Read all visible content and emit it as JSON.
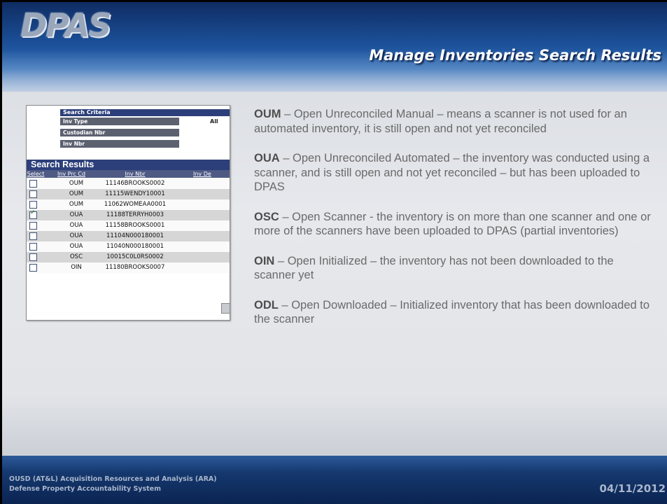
{
  "header": {
    "logo_text": "DPAS",
    "title": "Manage Inventories Search Results"
  },
  "inset": {
    "criteria_header": "Search Criteria",
    "criteria": [
      {
        "label": "Inv Type",
        "value": "All"
      },
      {
        "label": "Custodian Nbr",
        "value": ""
      },
      {
        "label": "Inv Nbr",
        "value": ""
      }
    ],
    "results_header": "Search Results",
    "columns": [
      "Select",
      "Inv Prc Cd",
      "Inv Nbr",
      "Inv De"
    ],
    "rows": [
      {
        "checked": false,
        "code": "OUM",
        "nbr": "11146BROOKS0002"
      },
      {
        "checked": false,
        "code": "OUM",
        "nbr": "11115WENDY10001"
      },
      {
        "checked": false,
        "code": "OUM",
        "nbr": "11062WOMEAA0001"
      },
      {
        "checked": true,
        "code": "OUA",
        "nbr": "11188TERRYH0003"
      },
      {
        "checked": false,
        "code": "OUA",
        "nbr": "11158BROOKS0001"
      },
      {
        "checked": false,
        "code": "OUA",
        "nbr": "11104N000180001"
      },
      {
        "checked": false,
        "code": "OUA",
        "nbr": "11040N000180001"
      },
      {
        "checked": false,
        "code": "OSC",
        "nbr": "10015C0L0RS0002"
      },
      {
        "checked": false,
        "code": "OIN",
        "nbr": "11180BROOKS0007"
      }
    ]
  },
  "definitions": [
    {
      "code": "OUM",
      "text": " – Open Unreconciled Manual – means a scanner is not used for an automated inventory, it is still open and not yet reconciled"
    },
    {
      "code": "OUA",
      "text": " – Open Unreconciled Automated – the inventory was conducted using a scanner, and is still open and not yet reconciled – but has been uploaded to DPAS"
    },
    {
      "code": "OSC",
      "text": " – Open Scanner - the inventory is on more than one scanner and one or more of the scanners have been uploaded to DPAS (partial inventories)"
    },
    {
      "code": "OIN",
      "text": " – Open Initialized – the inventory has not been downloaded to the scanner yet"
    },
    {
      "code": "ODL",
      "text": " – Open Downloaded – Initialized inventory that has been downloaded to the scanner"
    }
  ],
  "footer": {
    "line1": "OUSD (AT&L) Acquisition Resources and Analysis (ARA)",
    "line2": "Defense Property Accountability System",
    "date": "04/11/2012"
  }
}
